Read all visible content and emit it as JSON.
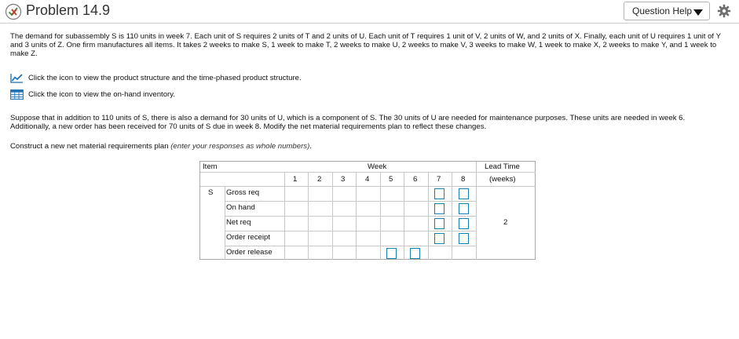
{
  "header": {
    "title": "Problem 14.9",
    "question_help": "Question Help"
  },
  "problem": {
    "intro": "The demand for subassembly S is 110 units in week 7. Each unit of S requires 2 units of T and 2 units of U. Each unit of T requires 1 unit of V, 2 units of W, and 2 units of X. Finally, each unit of U requires 1 unit of Y and 3 units of Z. One firm manufactures all items. It takes 2 weeks to make S, 1 week to make T, 2 weeks to make U, 2 weeks to make V, 3 weeks to make W, 1 week to make X, 2 weeks to make Y, and 1 week to make Z.",
    "link_structure": "Click the icon to view the product structure and the time-phased product structure.",
    "link_inventory": "Click the icon to view the on-hand inventory.",
    "scenario": "Suppose that in addition to 110 units of S, there is also a demand for 30 units of U, which is a component of S. The 30 units of U are needed for maintenance purposes. These units are needed in week 6. Additionally, a new order has been received for 70 units of S due in week 8. Modify the net material requirements plan to reflect these changes.",
    "instruction_main": "Construct a new net material requirements plan ",
    "instruction_hint": "(enter your responses as whole numbers)",
    "instruction_end": "."
  },
  "table": {
    "item_header": "Item",
    "week_header": "Week",
    "lead_time_header": "Lead Time",
    "lead_time_unit": "(weeks)",
    "weeks": [
      "1",
      "2",
      "3",
      "4",
      "5",
      "6",
      "7",
      "8"
    ],
    "item": "S",
    "rows": [
      "Gross req",
      "On hand",
      "Net req",
      "Order receipt",
      "Order release"
    ],
    "lead_time_value": "2",
    "inputs": {
      "gross_req": [
        "",
        ""
      ],
      "on_hand": [
        "",
        ""
      ],
      "net_req": [
        "",
        ""
      ],
      "order_receipt": [
        "",
        ""
      ],
      "order_release": [
        "",
        ""
      ]
    }
  },
  "colors": {
    "input_border": "#1a7fb6",
    "status_icon": "#c0392b"
  },
  "icons": {
    "status": "partial-correct-icon",
    "dropdown": "caret-down-icon",
    "settings": "gear-icon",
    "chart_link": "chart-icon",
    "table_link": "table-icon"
  }
}
